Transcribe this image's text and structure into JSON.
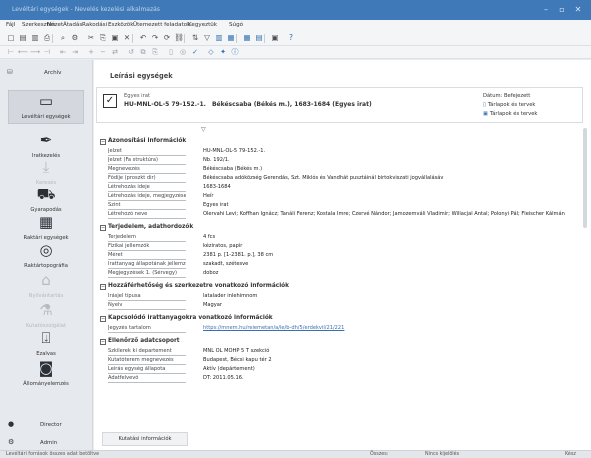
{
  "window": {
    "title": "Levéltári egységek - Nevelés kezelési alkalmazás"
  },
  "menu": [
    "Fájl",
    "Szerkesztés",
    "Nézet",
    "Átadás",
    "Rakodási",
    "Eszközök",
    "Ütemezett feladatok",
    "Kegyeztük",
    "Súgó"
  ],
  "toolbar1_icons": [
    "new-doc-icon",
    "save-icon",
    "print-icon",
    "export-icon",
    "search-icon",
    "settings-icon",
    "cut-icon",
    "copy-icon",
    "paste-icon",
    "delete-icon",
    "undo-icon",
    "redo-icon",
    "refresh-icon",
    "link-icon",
    "sort-icon",
    "filter-icon",
    "columns-icon",
    "export-table-icon",
    "grid-icon",
    "table-icon",
    "view-icon",
    "help-icon"
  ],
  "toolbar2_icons": [
    "first-icon",
    "prev-icon",
    "next-icon",
    "last-icon",
    "back-icon",
    "forward-icon",
    "add-icon",
    "remove-icon",
    "move-icon",
    "restore-icon",
    "clone-icon",
    "attach-icon",
    "lock-icon",
    "unlock-icon",
    "check-icon",
    "tag-icon",
    "star-icon",
    "info-icon"
  ],
  "sidebar": {
    "header": "Archív",
    "items": [
      {
        "label": "Levéltári egységek",
        "icon": "ui-icon",
        "glyph": "▭",
        "active": true,
        "dim": false
      },
      {
        "label": "Iratkezelés",
        "icon": "pen-icon",
        "glyph": "✒",
        "active": false,
        "dim": false
      },
      {
        "label": "Keresés",
        "icon": "download-icon",
        "glyph": "⤓",
        "active": false,
        "dim": true
      },
      {
        "label": "Gyarapodás",
        "icon": "truck-icon",
        "glyph": "⛟",
        "active": false,
        "dim": false
      },
      {
        "label": "Raktári egységek",
        "icon": "archive-box-icon",
        "glyph": "▦",
        "active": false,
        "dim": false
      },
      {
        "label": "Raktártopográfia",
        "icon": "compass-icon",
        "glyph": "◎",
        "active": false,
        "dim": false
      },
      {
        "label": "Nyilvántartás",
        "icon": "building-icon",
        "glyph": "⌂",
        "active": false,
        "dim": true
      },
      {
        "label": "Kutatószolgálat",
        "icon": "graduation-cap-icon",
        "glyph": "⚗",
        "active": false,
        "dim": true
      },
      {
        "label": "Ezalvas",
        "icon": "mailbox-icon",
        "glyph": "⍗",
        "active": false,
        "dim": false
      },
      {
        "label": "Állományelemzés",
        "icon": "camera-icon",
        "glyph": "◙",
        "active": false,
        "dim": false
      }
    ],
    "footer": [
      {
        "label": "Director",
        "icon": "user-icon",
        "glyph": "●"
      },
      {
        "label": "Admin",
        "icon": "tools-icon",
        "glyph": "⚙"
      }
    ]
  },
  "main": {
    "title": "Leírási egységek",
    "card": {
      "type_label": "Egyes irat",
      "reference": "HU-MNL-OL-5 79-152.-1.",
      "place_date": "Békéscsaba (Békés m.), 1683-1684 (Egyes irat)",
      "status": "Dátum: Befejezett",
      "link1": "Tárlapok és tervek",
      "link2": "Tárlapok és tervek"
    },
    "sections": [
      {
        "title": "Azonosítási információk",
        "rows": [
          [
            "Jelzet",
            "HU-MNL-OL-5 79-152.-1."
          ],
          [
            "Jelzet (Fa struktúra)",
            "Nb. 192/1."
          ],
          [
            "Megnevezés",
            "Békéscsaba (Békés m.)"
          ],
          [
            "Fődíje (proszkt dir)",
            "Békéscsaba adóközség Gerendás, Szt. Miklós és Vandhát pusztáinál birtokviszati jogvállalásáv"
          ],
          [
            "Létrehozás ideje",
            "1683-1684"
          ],
          [
            "Létrehozás ideje, megjegyzések",
            "Heír"
          ],
          [
            "Szint",
            "Egyes irat"
          ],
          [
            "Létrehozó neve",
            "Olervahi Levi; Koffhan Ignácz; Tanáli Ferenz; Kostala Imre; Czervé Nándor; Jamozemváli Vladimír; Willacjal Antal; Polonyi Pál; Fleischer Kálmán"
          ]
        ]
      },
      {
        "title": "Terjedelem, adathordozók",
        "rows": [
          [
            "Terjedelem",
            "4 fcs"
          ],
          [
            "Fizikai jellemzők",
            "kéziratos, papír"
          ],
          [
            "Méret",
            "2381 p. [1-2381. p.], 38 cm"
          ],
          [
            "Irattanyag állapotának jellemzői",
            "szakadt, szétesve"
          ],
          [
            "Megjegyzések 1. (Sérvegy)",
            "doboz"
          ]
        ]
      },
      {
        "title": "Hozzáférhetőség és szerkezetre vonatkozó információk",
        "rows": [
          [
            "Írásjel típusa",
            "latalader inlehimnom"
          ],
          [
            "Nyelv",
            "Magyar"
          ]
        ]
      },
      {
        "title": "Kapcsolódó irattanyagokra vonatkozó információk",
        "rows": [
          [
            "Jegyzés tartalom",
            "https://mnem.hu/reiemetan/a/le/b-dh/5/erdekvil/21/221"
          ]
        ]
      },
      {
        "title": "Ellenőrző adatcsoport",
        "rows": [
          [
            "Szkilerek ki departement",
            "MNL OL MOHP 5 T szekció"
          ],
          [
            "Kutatóterem megnevezés",
            "Budapest, Bécsi kapu tér 2"
          ],
          [
            "Leírás egység állapota",
            "Aktív (depártement)"
          ],
          [
            "Adatfelvevő",
            "DT: 2011.05.16."
          ]
        ]
      }
    ],
    "bottom_tab": "Kutatási információk"
  },
  "statusbar": {
    "left": "Levéltári források összes adat betöltve",
    "mid": "Összes:",
    "mid2": "Nincs kijelölés",
    "right": "Kész"
  }
}
